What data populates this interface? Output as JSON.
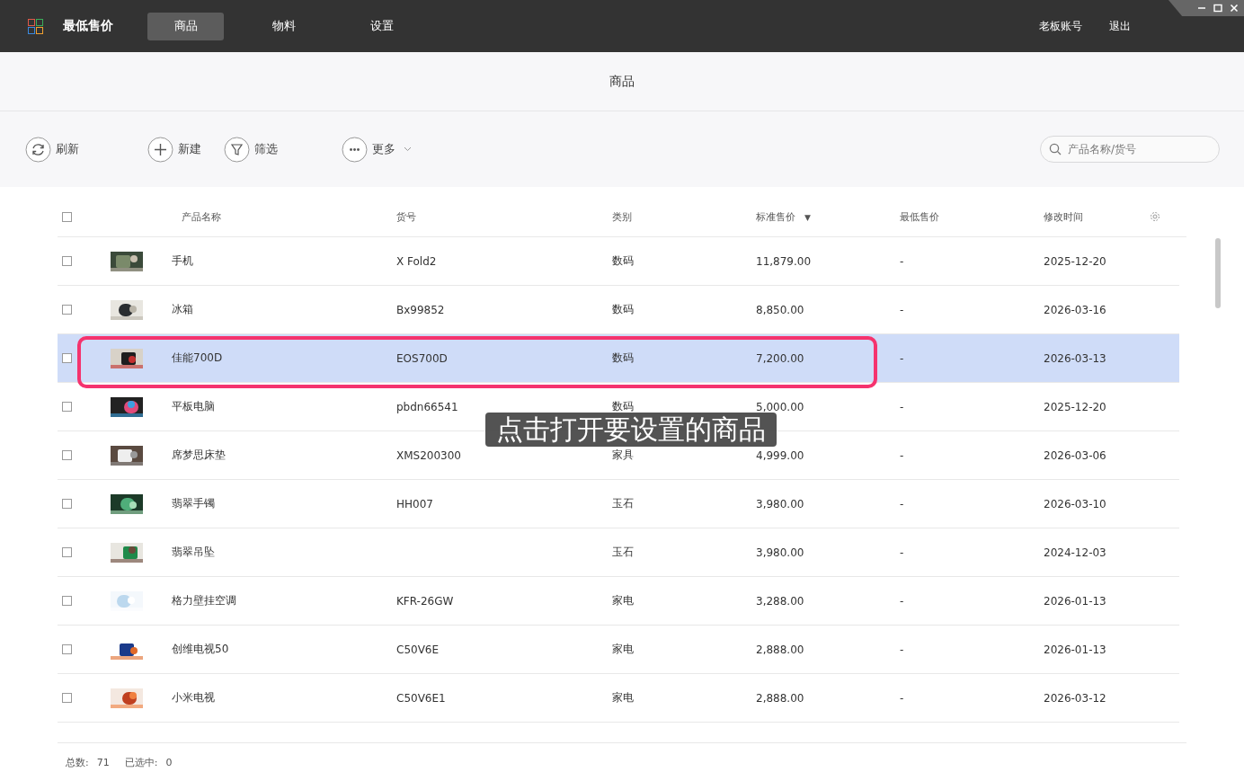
{
  "app": {
    "title": "最低售价"
  },
  "nav": [
    {
      "label": "商品",
      "selected": true
    },
    {
      "label": "物料",
      "selected": false
    },
    {
      "label": "设置",
      "selected": false
    }
  ],
  "account": {
    "user": "老板账号",
    "logout": "退出"
  },
  "page_title": "商品",
  "toolbar": [
    {
      "kind": "refresh",
      "label": "刷新"
    },
    {
      "kind": "add",
      "label": "新建"
    },
    {
      "kind": "filter",
      "label": "筛选"
    },
    {
      "kind": "more",
      "label": "更多"
    }
  ],
  "search": {
    "placeholder": "产品名称/货号"
  },
  "table": {
    "columns": [
      "产品名称",
      "货号",
      "类别",
      "标准售价",
      "最低售价",
      "修改时间"
    ],
    "sort_indicator": "▼",
    "header_checked": false,
    "rows": [
      {
        "name": "手机",
        "code": "X Fold2",
        "category": "数码",
        "price": "11,879.00",
        "min_price": "-",
        "modified": "2025-12-20",
        "checked": false,
        "selected": false
      },
      {
        "name": "冰箱",
        "code": "Bx99852",
        "category": "数码",
        "price": "8,850.00",
        "min_price": "-",
        "modified": "2026-03-16",
        "checked": false,
        "selected": false
      },
      {
        "name": "佳能700D",
        "code": "EOS700D",
        "category": "数码",
        "price": "7,200.00",
        "min_price": "-",
        "modified": "2026-03-13",
        "checked": false,
        "selected": true
      },
      {
        "name": "平板电脑",
        "code": "pbdn66541",
        "category": "数码",
        "price": "5,000.00",
        "min_price": "-",
        "modified": "2025-12-20",
        "checked": false,
        "selected": false
      },
      {
        "name": "席梦思床垫",
        "code": "XMS200300",
        "category": "家具",
        "price": "4,999.00",
        "min_price": "-",
        "modified": "2026-03-06",
        "checked": false,
        "selected": false
      },
      {
        "name": "翡翠手镯",
        "code": "HH007",
        "category": "玉石",
        "price": "3,980.00",
        "min_price": "-",
        "modified": "2026-03-10",
        "checked": false,
        "selected": false
      },
      {
        "name": "翡翠吊坠",
        "code": "",
        "category": "玉石",
        "price": "3,980.00",
        "min_price": "-",
        "modified": "2024-12-03",
        "checked": false,
        "selected": false
      },
      {
        "name": "格力壁挂空调",
        "code": "KFR-26GW",
        "category": "家电",
        "price": "3,288.00",
        "min_price": "-",
        "modified": "2026-01-13",
        "checked": false,
        "selected": false
      },
      {
        "name": "创维电视50",
        "code": "C50V6E",
        "category": "家电",
        "price": "2,888.00",
        "min_price": "-",
        "modified": "2026-01-13",
        "checked": false,
        "selected": false
      },
      {
        "name": "小米电视",
        "code": "C50V6E1",
        "category": "家电",
        "price": "2,888.00",
        "min_price": "-",
        "modified": "2026-03-12",
        "checked": false,
        "selected": false
      }
    ]
  },
  "footer": {
    "total_label": "总数:",
    "total": "71",
    "selected_label": "已选中:",
    "selected_count": "0"
  },
  "caption": "点击打开要设置的商品"
}
